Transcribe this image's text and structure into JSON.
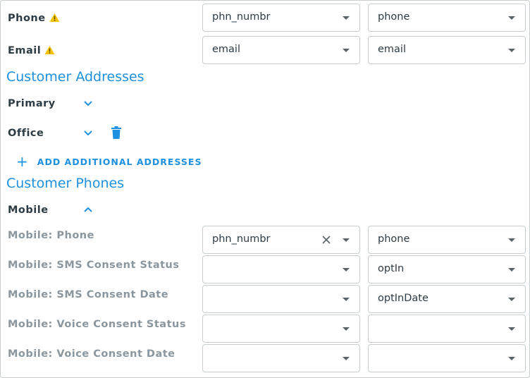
{
  "fields": {
    "phone": {
      "label": "Phone",
      "source": "phn_numbr",
      "target": "phone"
    },
    "email": {
      "label": "Email",
      "source": "email",
      "target": "email"
    }
  },
  "addresses": {
    "title": "Customer Addresses",
    "items": [
      {
        "label": "Primary"
      },
      {
        "label": "Office"
      }
    ],
    "add_label": "ADD ADDITIONAL ADDRESSES"
  },
  "phones": {
    "title": "Customer Phones",
    "group_label": "Mobile",
    "rows": [
      {
        "label": "Mobile: Phone",
        "source": "phn_numbr",
        "target": "phone"
      },
      {
        "label": "Mobile: SMS Consent Status",
        "source": "",
        "target": "optIn"
      },
      {
        "label": "Mobile: SMS Consent Date",
        "source": "",
        "target": "optInDate"
      },
      {
        "label": "Mobile: Voice Consent Status",
        "source": "",
        "target": ""
      },
      {
        "label": "Mobile: Voice Consent Date",
        "source": "",
        "target": ""
      }
    ]
  },
  "icons": {
    "warning": "warning-triangle-icon",
    "chevron_down": "chevron-down-icon",
    "chevron_up": "chevron-up-icon",
    "trash": "trash-icon",
    "clear": "close-icon",
    "caret": "caret-down-icon",
    "plus": "plus-icon"
  },
  "colors": {
    "accent": "#1e90e0",
    "warning": "#f5c400",
    "text": "#2d3b45",
    "muted": "#8b969e",
    "border": "#c7cdd1"
  }
}
